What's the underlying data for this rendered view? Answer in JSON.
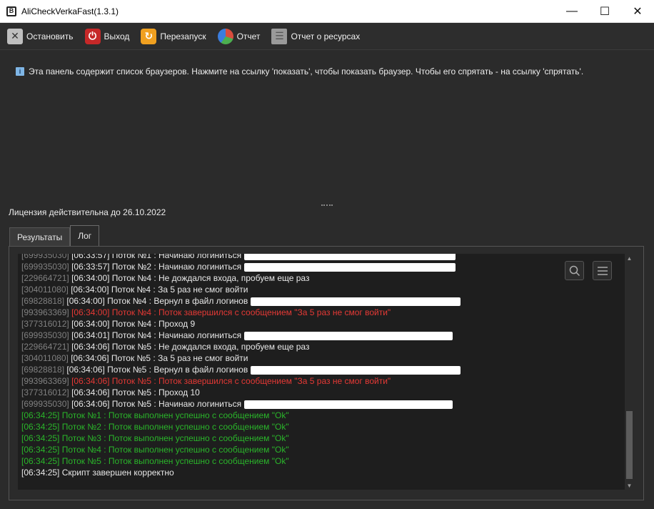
{
  "window": {
    "title": "AliCheckVerkaFast(1.3.1)",
    "controls": {
      "minimize": "—",
      "maximize": "☐",
      "close": "✕"
    }
  },
  "toolbar": {
    "stop_label": "Остановить",
    "exit_label": "Выход",
    "restart_label": "Перезапуск",
    "report_label": "Отчет",
    "resources_label": "Отчет о ресурсах"
  },
  "browser_panel": {
    "info_text": "Эта панель содержит список браузеров. Нажмите на ссылку 'показать', чтобы показать браузер. Чтобы его спрятать - на ссылку 'спрятать'."
  },
  "license_text": "Лицензия действительна до 26.10.2022",
  "tabs": [
    {
      "label": "Результаты",
      "active": false
    },
    {
      "label": "Лог",
      "active": true
    }
  ],
  "log": {
    "lines": [
      {
        "id": "[699935030]",
        "text": "[06:33:57] Поток №1 : Начинаю логиниться",
        "color": "white",
        "redacted": true
      },
      {
        "id": "[699935030]",
        "text": "[06:33:57] Поток №2 : Начинаю логиниться",
        "color": "white",
        "redacted": true
      },
      {
        "id": "[229664721]",
        "text": "[06:34:00] Поток №4 : Не дождался входа, пробуем еще раз",
        "color": "white",
        "redacted": false
      },
      {
        "id": "[304011080]",
        "text": "[06:34:00] Поток №4 : За 5 раз не смог войти",
        "color": "white",
        "redacted": false
      },
      {
        "id": "[69828818]",
        "text": "[06:34:00] Поток №4 : Вернул в файл логинов",
        "color": "white",
        "redacted": true
      },
      {
        "id": "[993963369]",
        "text": "[06:34:00] Поток №4 : Поток завершился с сообщением \"За 5 раз не смог войти\"",
        "color": "red",
        "redacted": false
      },
      {
        "id": "[377316012]",
        "text": "[06:34:00] Поток №4 : Проход 9",
        "color": "white",
        "redacted": false
      },
      {
        "id": "[699935030]",
        "text": "[06:34:01] Поток №4 : Начинаю логиниться",
        "color": "white",
        "redacted": true
      },
      {
        "id": "[229664721]",
        "text": "[06:34:06] Поток №5 : Не дождался входа, пробуем еще раз",
        "color": "white",
        "redacted": false
      },
      {
        "id": "[304011080]",
        "text": "[06:34:06] Поток №5 : За 5 раз не смог войти",
        "color": "white",
        "redacted": false
      },
      {
        "id": "[69828818]",
        "text": "[06:34:06] Поток №5 : Вернул в файл логинов",
        "color": "white",
        "redacted": true
      },
      {
        "id": "[993963369]",
        "text": "[06:34:06] Поток №5 : Поток завершился с сообщением \"За 5 раз не смог войти\"",
        "color": "red",
        "redacted": false
      },
      {
        "id": "[377316012]",
        "text": "[06:34:06] Поток №5 : Проход 10",
        "color": "white",
        "redacted": false
      },
      {
        "id": "[699935030]",
        "text": "[06:34:06] Поток №5 : Начинаю логиниться",
        "color": "white",
        "redacted": true
      },
      {
        "id": "",
        "text": "[06:34:25] Поток №1 : Поток выполнен успешно с сообщением \"Ok\"",
        "color": "green",
        "redacted": false
      },
      {
        "id": "",
        "text": "[06:34:25] Поток №2 : Поток выполнен успешно с сообщением \"Ok\"",
        "color": "green",
        "redacted": false
      },
      {
        "id": "",
        "text": "[06:34:25] Поток №3 : Поток выполнен успешно с сообщением \"Ok\"",
        "color": "green",
        "redacted": false
      },
      {
        "id": "",
        "text": "[06:34:25] Поток №4 : Поток выполнен успешно с сообщением \"Ok\"",
        "color": "green",
        "redacted": false
      },
      {
        "id": "",
        "text": "[06:34:25] Поток №5 : Поток выполнен успешно с сообщением \"Ok\"",
        "color": "green",
        "redacted": false
      },
      {
        "id": "",
        "text": "[06:34:25] Скрипт завершен корректно",
        "color": "white",
        "redacted": false
      }
    ]
  },
  "icons": {
    "stop": "stop-icon",
    "exit": "power-icon",
    "restart": "restart-icon",
    "report": "pie-chart-icon",
    "resources": "list-icon",
    "search": "search-icon",
    "menu": "menu-icon"
  },
  "colors": {
    "log_white": "#e8e8e8",
    "log_red": "#e53935",
    "log_green": "#2ab52a",
    "log_id": "#808080"
  }
}
